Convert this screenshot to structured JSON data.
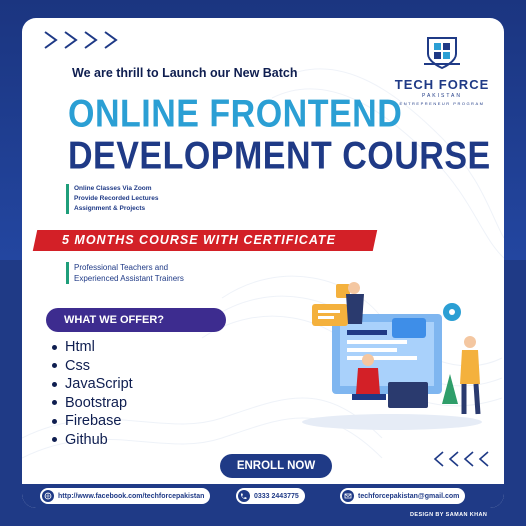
{
  "header": {
    "intro": "We are thrill to Launch our New Batch",
    "title_line1": "ONLINE FRONTEND",
    "title_line2": "DEVELOPMENT COURSE"
  },
  "logo": {
    "name": "TECH FORCE",
    "country": "PAKISTAN",
    "tagline": "ENTREPRENEUR PROGRAM"
  },
  "features": [
    "Online Classes Via Zoom",
    "Provide Recorded Lectures",
    "Assignment & Projects"
  ],
  "banner": {
    "text": "5 MONTHS COURSE WITH CERTIFICATE"
  },
  "teachers": [
    "Professional Teachers and",
    "Experienced Assistant Trainers"
  ],
  "offer": {
    "title": "WHAT WE OFFER?",
    "items": [
      "Html",
      "Css",
      "JavaScript",
      "Bootstrap",
      "Firebase",
      "Github"
    ]
  },
  "cta": {
    "label": "ENROLL NOW"
  },
  "contacts": {
    "facebook": "http://www.facebook.com/techforcepakistan",
    "phone": "0333 2443775",
    "email": "techforcepakistan@gmail.com"
  },
  "credit": "DESIGN BY   SAMAN KHAN",
  "icons": [
    "globe-icon",
    "phone-icon",
    "mail-icon",
    "chevron-right-icon",
    "chevron-left-icon"
  ],
  "colors": {
    "navy": "#1f3a86",
    "cyan": "#2b9fd4",
    "red": "#d32027",
    "purple": "#3d2c8f",
    "green": "#1f9e7a"
  }
}
